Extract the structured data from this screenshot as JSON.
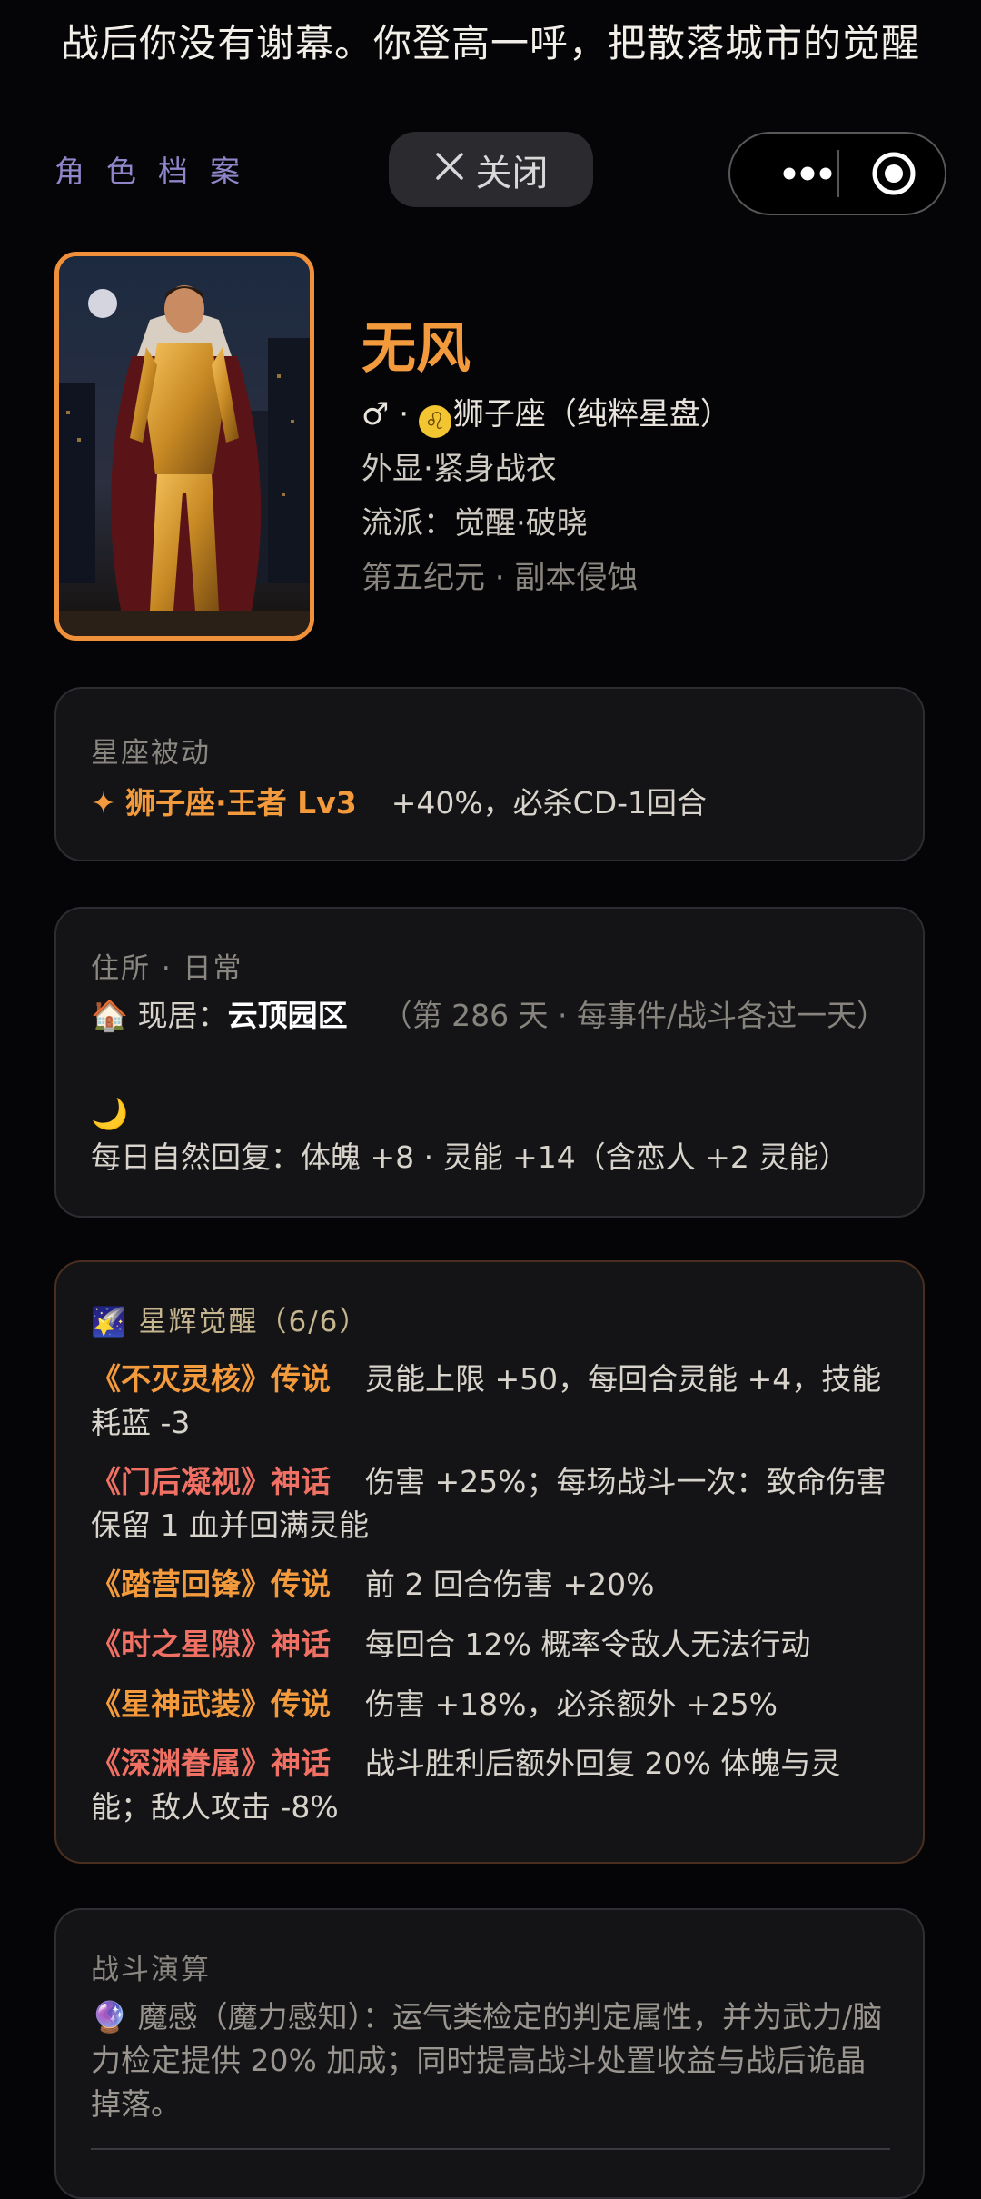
{
  "top_text": "战后你没有谢幕。你登高一呼，把散落城市的觉醒",
  "header": {
    "section_label": "角色档案",
    "close_label": "关闭"
  },
  "profile": {
    "name": "无风",
    "gender_symbol": "♂",
    "dot": "·",
    "zodiac_icon": "♌",
    "zodiac": "狮子座（纯粹星盘）",
    "appearance": "外显·紧身战衣",
    "school": "流派：觉醒·破晓",
    "era": "第五纪元 · 副本侵蚀"
  },
  "passive": {
    "title": "星座被动",
    "icon": "✦",
    "skill": "狮子座·王者 Lv3",
    "effect": "+40%，必杀CD-1回合"
  },
  "residence": {
    "title": "住所 · 日常",
    "home_icon": "🏠",
    "home_label": "现居：",
    "home_name": "云顶园区",
    "home_note": "（第 286 天 · 每事件/战斗各过一天）",
    "moon_icon": "🌙",
    "recovery": "每日自然回复：体魄 +8 · 灵能 +14（含恋人 +2 灵能）"
  },
  "awakening": {
    "icon": "🌠",
    "title": "星辉觉醒（6/6）",
    "items": [
      {
        "name": "《不灭灵核》传说",
        "effect": "灵能上限 +50，每回合灵能 +4，技能耗蓝 -3"
      },
      {
        "name": "《门后凝视》神话",
        "effect": "伤害 +25%；每场战斗一次：致命伤害保留 1 血并回满灵能"
      },
      {
        "name": "《踏营回锋》传说",
        "effect": "前 2 回合伤害 +20%"
      },
      {
        "name": "《时之星隙》神话",
        "effect": "每回合 12% 概率令敌人无法行动"
      },
      {
        "name": "《星神武装》传说",
        "effect": "伤害 +18%，必杀额外 +25%"
      },
      {
        "name": "《深渊眷属》神话",
        "effect": "战斗胜利后额外回复 20% 体魄与灵能；敌人攻击 -8%"
      }
    ]
  },
  "battle": {
    "title": "战斗演算",
    "icon": "🔮",
    "text": "魔感（魔力感知）：运气类检定的判定属性，并为武力/脑力检定提供 20% 加成；同时提高战斗处置收益与战后诡晶掉落。"
  },
  "colors": {
    "accent_gold": "#f39a3c",
    "accent_red": "#f07063",
    "label_purple": "#8f86c9",
    "background": "#050507",
    "card": "#141417"
  }
}
